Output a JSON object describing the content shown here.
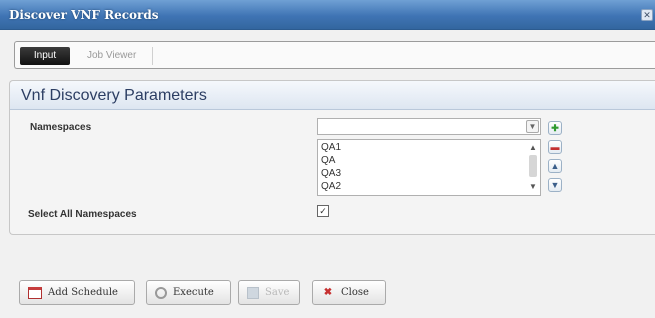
{
  "window": {
    "title": "Discover VNF Records",
    "close_glyph": "✕"
  },
  "tabs": [
    {
      "label": "Input",
      "selected": true
    },
    {
      "label": "Job Viewer",
      "selected": false
    }
  ],
  "panel": {
    "title": "Vnf Discovery Parameters",
    "namespaces_label": "Namespaces",
    "combo_value": "",
    "namespaces": [
      "QA1",
      "QA",
      "QA3",
      "QA2"
    ],
    "select_all_label": "Select All Namespaces",
    "select_all_checked": true
  },
  "side_buttons": {
    "add_icon": "add-icon",
    "remove_icon": "remove-icon",
    "move_up_icon": "move-up-icon",
    "move_down_icon": "move-down-icon"
  },
  "buttons": {
    "add_schedule": "Add Schedule",
    "execute": "Execute",
    "save": "Save",
    "close": "Close"
  },
  "colors": {
    "titlebar": "#3f74b4",
    "panel_title": "#2c3e63",
    "add_green": "#2f9a2f",
    "remove_red": "#c43030"
  }
}
